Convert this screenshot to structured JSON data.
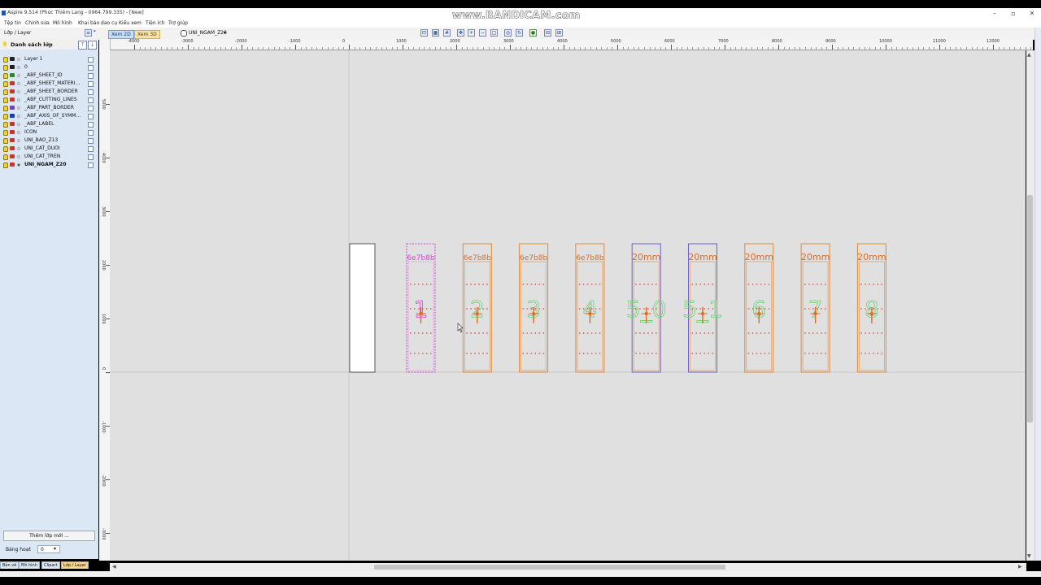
{
  "window": {
    "title": "Aspire 9.514 (Phúc Thiêm Lang - 0964.799.335) - [New]",
    "watermark": "www.BANDICAM.com"
  },
  "menu": [
    "Tệp tin",
    "Chỉnh sửa",
    "Mô hình",
    "Khai báo dao cụ",
    "Kiểu xem",
    "Tiện ích",
    "Trợ giúp"
  ],
  "toolbar": {
    "panel_title": "Lớp / Layer",
    "view_tabs": [
      "Xem 2D",
      "Xem 3D"
    ],
    "active_layer": "UNI_NGAM_Z20"
  },
  "layers_panel": {
    "title": "Danh sách lớp",
    "layers": [
      {
        "name": "Layer 1",
        "color": "#222222",
        "bold": false
      },
      {
        "name": "0",
        "color": "#222222",
        "bold": false
      },
      {
        "name": "_ABF_SHEET_ID",
        "color": "#2a8a2a",
        "bold": false
      },
      {
        "name": "_ABF_SHEET_MATERI...",
        "color": "#c0392b",
        "bold": false
      },
      {
        "name": "_ABF_SHEET_BORDER",
        "color": "#c0392b",
        "bold": false
      },
      {
        "name": "_ABF_CUTTING_LINES",
        "color": "#c0392b",
        "bold": false
      },
      {
        "name": "_ABF_PART_BORDER",
        "color": "#7a3fb0",
        "bold": false
      },
      {
        "name": "_ABF_AXIS_OF_SYMM...",
        "color": "#1a3fb0",
        "bold": false
      },
      {
        "name": "_ABF_LABEL",
        "color": "#c0392b",
        "bold": false
      },
      {
        "name": "ICON",
        "color": "#c0392b",
        "bold": false
      },
      {
        "name": "UNI_BAO_Z13",
        "color": "#c0392b",
        "bold": false
      },
      {
        "name": "UNI_CAT_DUOI",
        "color": "#c0392b",
        "bold": false
      },
      {
        "name": "UNI_CAT_TREN",
        "color": "#c0392b",
        "bold": false
      },
      {
        "name": "UNI_NGAM_Z20",
        "color": "#c0392b",
        "bold": true
      }
    ],
    "add_layer_button": "Thêm lớp mới ...",
    "sheet_label": "Bảng hoạt",
    "sheet_value": "0"
  },
  "bottom_tabs": [
    "Bản vẽ",
    "Mô hình",
    "Clipart",
    "Lớp / Layer"
  ],
  "ruler": {
    "h_labels": [
      "-4000",
      "-3000",
      "-2000",
      "-1000",
      "0",
      "1000",
      "2000",
      "3000",
      "4000",
      "5000",
      "6000",
      "7000",
      "8000",
      "9000",
      "10000",
      "11000",
      "12000"
    ],
    "v_labels": [
      "5000",
      "4000",
      "3000",
      "2000",
      "1000",
      "0",
      "-1000",
      "-2000",
      "-3000"
    ]
  },
  "parts": [
    {
      "label": "6e7b8b",
      "number": "1",
      "border": "#d63fd6",
      "text": "#d63fd6",
      "dashed": true
    },
    {
      "label": "6e7b8b",
      "number": "2",
      "border": "#e08a3a",
      "text": "#d66d2a",
      "dashed": false
    },
    {
      "label": "6e7b8b",
      "number": "3",
      "border": "#e08a3a",
      "text": "#d66d2a",
      "dashed": false
    },
    {
      "label": "6e7b8b",
      "number": "4",
      "border": "#e08a3a",
      "text": "#d66d2a",
      "dashed": false
    },
    {
      "label": "20mm",
      "number": "5_0",
      "border": "#6a5fd0",
      "text": "#d66d2a",
      "dashed": false
    },
    {
      "label": "20mm",
      "number": "5_1",
      "border": "#6a5fd0",
      "text": "#d66d2a",
      "dashed": false
    },
    {
      "label": "20mm",
      "number": "6",
      "border": "#e08a3a",
      "text": "#d66d2a",
      "dashed": false
    },
    {
      "label": "20mm",
      "number": "7",
      "border": "#e08a3a",
      "text": "#d66d2a",
      "dashed": false
    },
    {
      "label": "20mm",
      "number": "8",
      "border": "#e08a3a",
      "text": "#d66d2a",
      "dashed": false
    }
  ]
}
